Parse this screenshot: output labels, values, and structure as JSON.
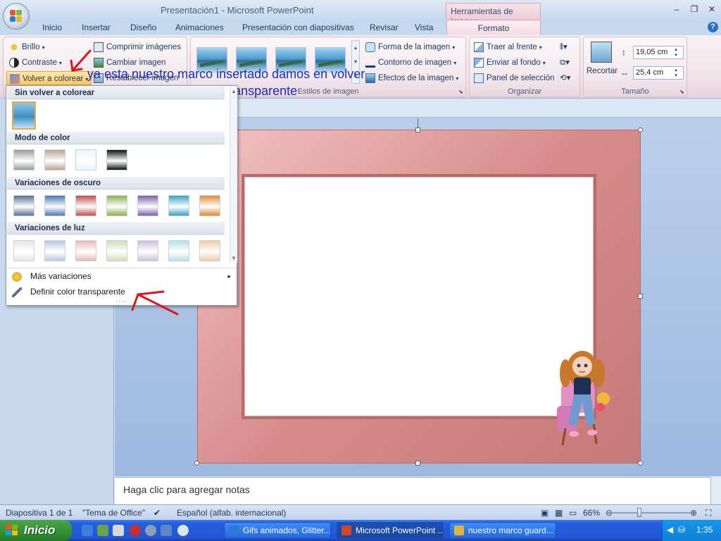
{
  "window": {
    "title": "Presentación1 - Microsoft PowerPoint",
    "context_tab_header": "Herramientas de imagen"
  },
  "tabs": [
    "Inicio",
    "Insertar",
    "Diseño",
    "Animaciones",
    "Presentación con diapositivas",
    "Revisar",
    "Vista"
  ],
  "active_tab": "Formato",
  "ribbon": {
    "ajustar": {
      "brillo": "Brillo",
      "contraste": "Contraste",
      "volver_a_colorear": "Volver a colorear",
      "comprimir": "Comprimir imágenes",
      "cambiar": "Cambiar imagen",
      "restablecer": "Restablecer imagen"
    },
    "estilos": {
      "label": "Estilos de imagen",
      "forma": "Forma de la imagen",
      "contorno": "Contorno de imagen",
      "efectos": "Efectos de la imagen"
    },
    "organizar": {
      "label": "Organizar",
      "traer": "Traer al frente",
      "enviar": "Enviar al fondo",
      "panel": "Panel de selección"
    },
    "tamano": {
      "label": "Tamaño",
      "recortar": "Recortar",
      "height": "19,05 cm",
      "width": "25,4 cm"
    }
  },
  "recolor_menu": {
    "section_none": "Sin volver a colorear",
    "section_color_mode": "Modo de color",
    "section_dark": "Variaciones de oscuro",
    "section_light": "Variaciones de luz",
    "more_variations": "Más variaciones",
    "set_transparent": "Definir color transparente",
    "color_mode_swatches": [
      "#9a9a9a",
      "#b9a58c",
      "#e9f6fb",
      "#111111"
    ],
    "dark_swatches": [
      "#5a6f93",
      "#4a76b8",
      "#c0504d",
      "#8cb04f",
      "#7a5fa8",
      "#3aa2c2",
      "#e08b35"
    ],
    "light_swatches": [
      "#e6e6e6",
      "#b7c9e2",
      "#e8b9b8",
      "#cfe0b5",
      "#cbbfdc",
      "#b6dfea",
      "#f3cba6"
    ]
  },
  "slide": {
    "text": " ya esta nuestro marco insertado damos en volver a colorear y definir color transparente"
  },
  "notes": {
    "placeholder": "Haga clic para agregar notas"
  },
  "status": {
    "slide_info": "Diapositiva 1 de 1",
    "theme": "\"Tema de Office\"",
    "language": "Español (alfab. internacional)",
    "zoom": "66%"
  },
  "taskbar": {
    "start": "Inicio",
    "tasks": [
      "Gifs animados, Glitter...",
      "Microsoft PowerPoint ...",
      "nuestro marco guard..."
    ],
    "clock": "1:35"
  }
}
